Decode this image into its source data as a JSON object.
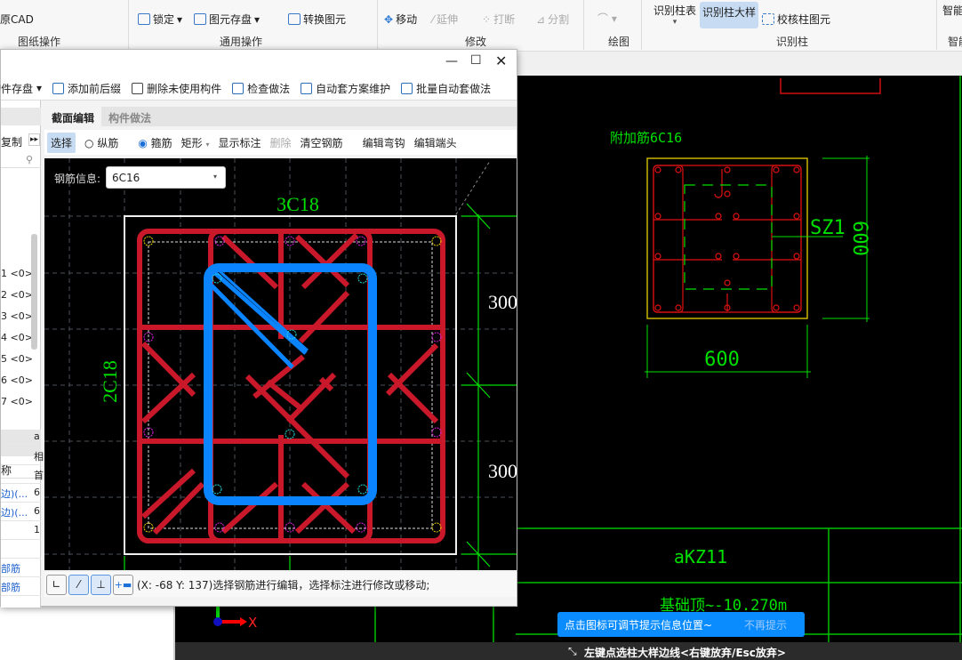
{
  "ribbon": {
    "groups": [
      {
        "label": "图纸操作",
        "items": [
          "原CAD"
        ]
      },
      {
        "label": "通用操作",
        "items": [
          "锁定",
          "图元存盘",
          "转换图元"
        ]
      },
      {
        "label": "修改",
        "items": [
          "移动",
          "延伸",
          "打断",
          "分割"
        ]
      },
      {
        "label": "绘图",
        "items": []
      },
      {
        "label": "识别柱",
        "items": [
          "识别柱表",
          "识别柱大样",
          "校核柱图元"
        ]
      },
      {
        "label": "智能",
        "items": [
          "智能"
        ]
      }
    ]
  },
  "dialog": {
    "toolbar": [
      "构件存盘",
      "添加前后缀",
      "删除未使用构件",
      "检查做法",
      "自动套方案维护",
      "批量自动套做法"
    ],
    "left_panel": {
      "copy_label": "复制",
      "list": [
        "1 <0>",
        "2 <0>",
        "3 <0>",
        "4 <0>",
        "5 <0>",
        "6 <0>",
        "7 <0>"
      ],
      "table_header": "称",
      "rows": [
        {
          "name": "",
          "value": "a"
        },
        {
          "name": "",
          "value": "相"
        },
        {
          "name": "",
          "value": "首"
        },
        {
          "name": "边)(...",
          "value": "6"
        },
        {
          "name": "边)(...",
          "value": "6"
        },
        {
          "name": "",
          "value": "1"
        },
        {
          "name": "",
          "value": ""
        },
        {
          "name": "部筋",
          "value": ""
        },
        {
          "name": "部筋",
          "value": ""
        }
      ]
    },
    "tabs": [
      {
        "label": "截面编辑",
        "active": true
      },
      {
        "label": "构件做法",
        "active": false
      }
    ],
    "edit_toolbar": {
      "select": "选择",
      "radio_longitudinal": "纵筋",
      "radio_stirrup": "箍筋",
      "selected_radio": "箍筋",
      "shape": "矩形",
      "show_label": "显示标注",
      "delete": "删除",
      "clear": "清空钢筋",
      "edit_hook": "编辑弯钩",
      "edit_end": "编辑端头"
    },
    "rebar_info_label": "钢筋信息:",
    "rebar_info_value": "6C16",
    "labels": {
      "top": "3C18",
      "side": "2C18",
      "dim1": "300",
      "dim2": "300"
    },
    "status": "(X: -68 Y: 137)选择钢筋进行编辑，选择标注进行修改或移动;"
  },
  "cad": {
    "extra_label": "附加筋6C16",
    "column_name": "SZ1",
    "dim_width": "600",
    "dim_height": "600",
    "detail_name": "aKZ11",
    "elevation": "基础顶~-10.270m",
    "axis_x": "X"
  },
  "tooltip": {
    "text": "点击图标可调节提示信息位置~",
    "dismiss": "不再提示"
  },
  "command": "左键点选柱大样边线<右键放弃/Esc放弃>",
  "colors": {
    "rebar": "#c8182a",
    "stirrup_selected": "#0a84ff",
    "cad_green": "#00e000",
    "tooltip": "#0a8cff"
  }
}
